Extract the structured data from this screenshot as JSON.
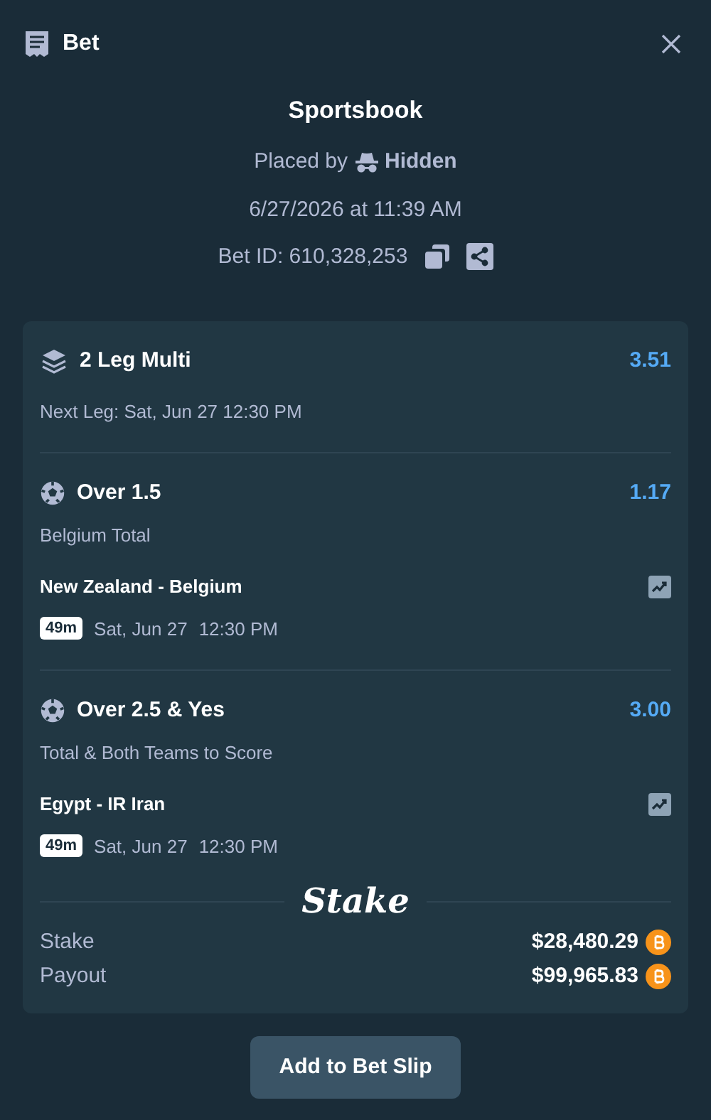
{
  "header": {
    "title": "Bet"
  },
  "summary": {
    "title": "Sportsbook",
    "placed_by_label": "Placed by",
    "placed_by_user": "Hidden",
    "date": "6/27/2026 at 11:39 AM",
    "bet_id": "Bet ID: 610,328,253"
  },
  "multi": {
    "title": "2 Leg Multi",
    "odds": "3.51",
    "next_leg": "Next Leg: Sat, Jun 27 12:30 PM"
  },
  "legs": [
    {
      "selection": "Over 1.5",
      "odds": "1.17",
      "market": "Belgium Total",
      "event": "New Zealand - Belgium",
      "countdown": "49m",
      "date": "Sat, Jun 27",
      "time": "12:30 PM"
    },
    {
      "selection": "Over 2.5 & Yes",
      "odds": "3.00",
      "market": "Total & Both Teams to Score",
      "event": "Egypt - IR Iran",
      "countdown": "49m",
      "date": "Sat, Jun 27",
      "time": "12:30 PM"
    }
  ],
  "logo": "Stake",
  "amounts": [
    {
      "label": "Stake",
      "value": "$28,480.29"
    },
    {
      "label": "Payout",
      "value": "$99,965.83"
    }
  ],
  "button": "Add to Bet Slip"
}
